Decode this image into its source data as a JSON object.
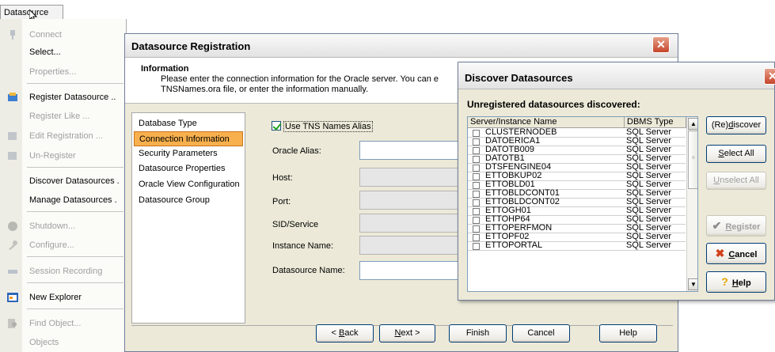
{
  "menu": {
    "title": "Datasource",
    "items": [
      {
        "label": "Connect",
        "enabled": false,
        "icon": "connect-icon"
      },
      {
        "label": "Select...",
        "enabled": true,
        "icon": ""
      },
      {
        "label": "Properties...",
        "enabled": false,
        "icon": ""
      },
      {
        "label": "Register Datasource ..",
        "enabled": true,
        "icon": "register-datasource-icon"
      },
      {
        "label": "Register Like ...",
        "enabled": false,
        "icon": ""
      },
      {
        "label": "Edit Registration ...",
        "enabled": false,
        "icon": "edit-registration-icon"
      },
      {
        "label": "Un-Register",
        "enabled": false,
        "icon": "unregister-icon"
      },
      {
        "label": "Discover Datasources .",
        "enabled": true,
        "icon": ""
      },
      {
        "label": "Manage Datasources .",
        "enabled": true,
        "icon": ""
      },
      {
        "label": "Shutdown...",
        "enabled": false,
        "icon": "shutdown-icon"
      },
      {
        "label": "Configure...",
        "enabled": false,
        "icon": "configure-icon"
      },
      {
        "label": "Session Recording",
        "enabled": false,
        "icon": "session-recording-icon"
      },
      {
        "label": "New Explorer",
        "enabled": true,
        "icon": "new-explorer-icon"
      },
      {
        "label": "Find Object...",
        "enabled": false,
        "icon": "find-object-icon"
      },
      {
        "label": "Objects",
        "enabled": false,
        "icon": ""
      }
    ]
  },
  "registration": {
    "title": "Datasource Registration",
    "info_title": "Information",
    "info_line1": "Please enter the connection information for the Oracle server.  You can e",
    "info_line2": "TNSNames.ora file, or enter the information manually.",
    "nav": [
      "Database Type",
      "Connection Information",
      "Security Parameters",
      "Datasource Properties",
      "Oracle View Configuration",
      "Datasource Group"
    ],
    "selected_nav": "Connection Information",
    "tns_checkbox": "Use TNS Names Alias",
    "tns_checked": true,
    "fields": [
      {
        "label": "Oracle Alias:",
        "value": "",
        "enabled": true
      },
      {
        "label": "Host:",
        "value": "",
        "enabled": false
      },
      {
        "label": "Port:",
        "value": "",
        "enabled": false
      },
      {
        "label": "SID/Service",
        "value": "",
        "enabled": false
      },
      {
        "label": "Instance Name:",
        "value": "",
        "enabled": false
      },
      {
        "label": "Datasource Name:",
        "value": "",
        "enabled": true
      }
    ],
    "buttons": {
      "back_arrow": "< ",
      "back_mn": "B",
      "back_rest": "ack",
      "next_mn": "N",
      "next_rest": "ext >",
      "finish": "Finish",
      "cancel": "Cancel",
      "help": "Help"
    }
  },
  "discover": {
    "title": "Discover Datasources",
    "subheading": "Unregistered datasources discovered:",
    "columns": [
      "Server/Instance Name",
      "DBMS Type"
    ],
    "rows": [
      {
        "name": "CLUSTERNODEB",
        "type": "SQL Server"
      },
      {
        "name": "DATOERICA1",
        "type": "SQL Server"
      },
      {
        "name": "DATOTB009",
        "type": "SQL Server"
      },
      {
        "name": "DATOTB1",
        "type": "SQL Server"
      },
      {
        "name": "DTSFENGINE04",
        "type": "SQL Server"
      },
      {
        "name": "ETTOBKUP02",
        "type": "SQL Server"
      },
      {
        "name": "ETTOBLD01",
        "type": "SQL Server"
      },
      {
        "name": "ETTOBLDCONT01",
        "type": "SQL Server"
      },
      {
        "name": "ETTOBLDCONT02",
        "type": "SQL Server"
      },
      {
        "name": "ETTOGH01",
        "type": "SQL Server"
      },
      {
        "name": "ETTOHP64",
        "type": "SQL Server"
      },
      {
        "name": "ETTOPERFMON",
        "type": "SQL Server"
      },
      {
        "name": "ETTOPF02",
        "type": "SQL Server"
      },
      {
        "name": "ETTOPORTAL",
        "type": "SQL Server"
      }
    ],
    "buttons": {
      "rediscover_a": "(Re)",
      "rediscover_mn": "d",
      "rediscover_b": "iscover",
      "select_all_mn": "S",
      "select_all_rest": "elect All",
      "unselect_all_mn": "U",
      "unselect_all_rest": "nselect All",
      "register_mn": "R",
      "register_rest": "egister",
      "cancel_mn": "C",
      "cancel_rest": "ancel",
      "help_mn": "H",
      "help_rest": "elp"
    },
    "icon_colors": {
      "register": "#8a8a8a",
      "cancel": "#d2401c",
      "help": "#e8a400"
    }
  }
}
